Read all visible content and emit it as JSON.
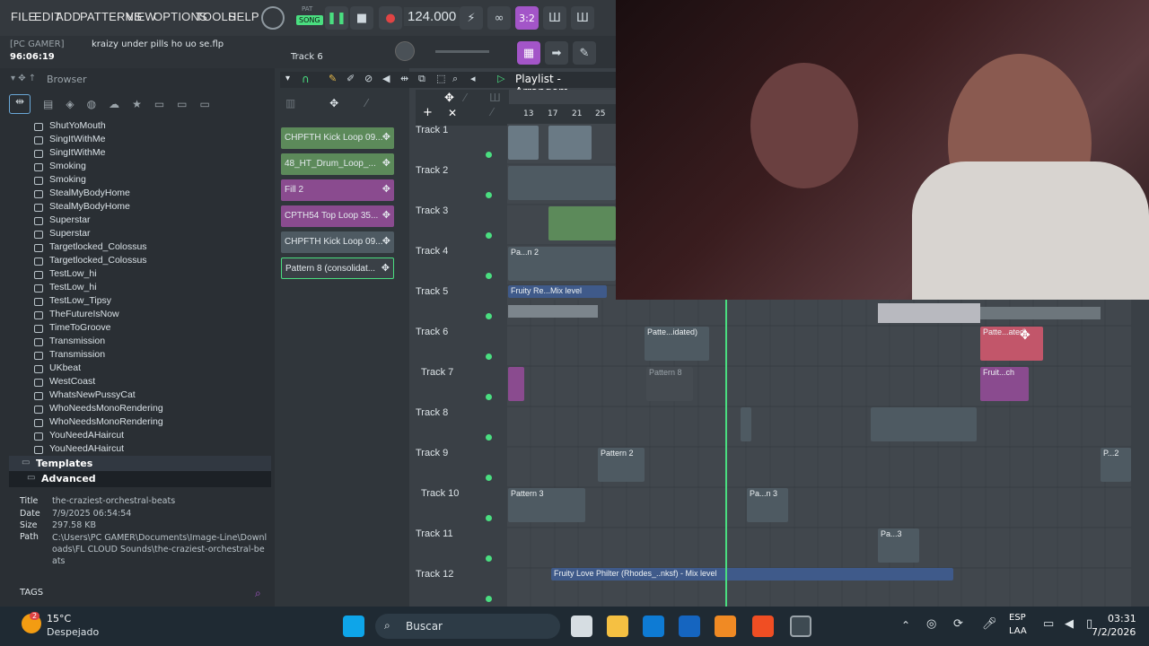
{
  "menu": [
    "FILE",
    "EDIT",
    "ADD",
    "PATTERNS",
    "VIEW",
    "OPTIONS",
    "TOOLS",
    "HELP"
  ],
  "transport": {
    "pat_label": "PAT",
    "song_label": "SONG",
    "tempo": "124.000",
    "snap": "3:2"
  },
  "project": {
    "user": "[PC GAMER]",
    "file": "kraizy under pills ho uo se.flp",
    "time": "96:06:19",
    "track_hint": "Track 6"
  },
  "browser": {
    "title": "Browser",
    "items": [
      "ShutYoMouth",
      "SingItWithMe",
      "SingItWithMe",
      "Smoking",
      "Smoking",
      "StealMyBodyHome",
      "StealMyBodyHome",
      "Superstar",
      "Superstar",
      "Targetlocked_Colossus",
      "Targetlocked_Colossus",
      "TestLow_hi",
      "TestLow_hi",
      "TestLow_Tipsy",
      "TheFutureIsNow",
      "TimeToGroove",
      "Transmission",
      "Transmission",
      "UKbeat",
      "WestCoast",
      "WhatsNewPussyCat",
      "WhoNeedsMonoRendering",
      "WhoNeedsMonoRendering",
      "YouNeedAHaircut",
      "YouNeedAHaircut"
    ],
    "folders": [
      "Templates",
      "Advanced"
    ],
    "info": {
      "title_label": "Title",
      "title": "the-craziest-orchestral-beats",
      "date_label": "Date",
      "date": "7/9/2025 06:54:54",
      "size_label": "Size",
      "size": "297.58 KB",
      "path_label": "Path",
      "path": "C:\\Users\\PC GAMER\\Documents\\Image-Line\\Downloads\\FL CLOUD Sounds\\the-craziest-orchestral-beats"
    },
    "tags_label": "TAGS"
  },
  "patterns": [
    "CHPFTH Kick Loop 09...",
    "48_HT_Drum_Loop_...",
    "Fill 2",
    "CPTH54 Top Loop 35...",
    "CHPFTH Kick Loop 09...",
    "Pattern 8 (consolidat..."
  ],
  "playlist": {
    "title": "Playlist - Arrangem...",
    "ruler": [
      "13",
      "17",
      "21",
      "25"
    ],
    "tracks": [
      "Track 1",
      "Track 2",
      "Track 3",
      "Track 4",
      "Track 5",
      "Track 6",
      "Track 7",
      "Track 8",
      "Track 9",
      "Track 10",
      "Track 11",
      "Track 12"
    ],
    "clips": {
      "t4": "Pa...n 2",
      "t5": "Fruity Re...Mix level",
      "t6a": "Patte...idated)",
      "t6b": "Patte...ated)",
      "t7a": "Pattern 8",
      "t7b": "Fruit...ch",
      "t9a": "Pattern 2",
      "t9b": "P...2",
      "t10a": "Pattern 3",
      "t10b": "Pa...n 3",
      "t11": "Pa...3",
      "t12": "Fruity Love Philter (Rhodes_..nksf) - Mix level"
    }
  },
  "taskbar": {
    "temp": "15°C",
    "weather": "Despejado",
    "search": "Buscar",
    "lang": "ESP",
    "lang2": "LAA",
    "time": "03:31",
    "date": "7/2/2026",
    "badge": "2"
  },
  "colors": {
    "accent": "#4ade80",
    "green_pat": "#5c8a5a",
    "purple": "#8a4b8f",
    "red_clip": "#c2566a"
  }
}
